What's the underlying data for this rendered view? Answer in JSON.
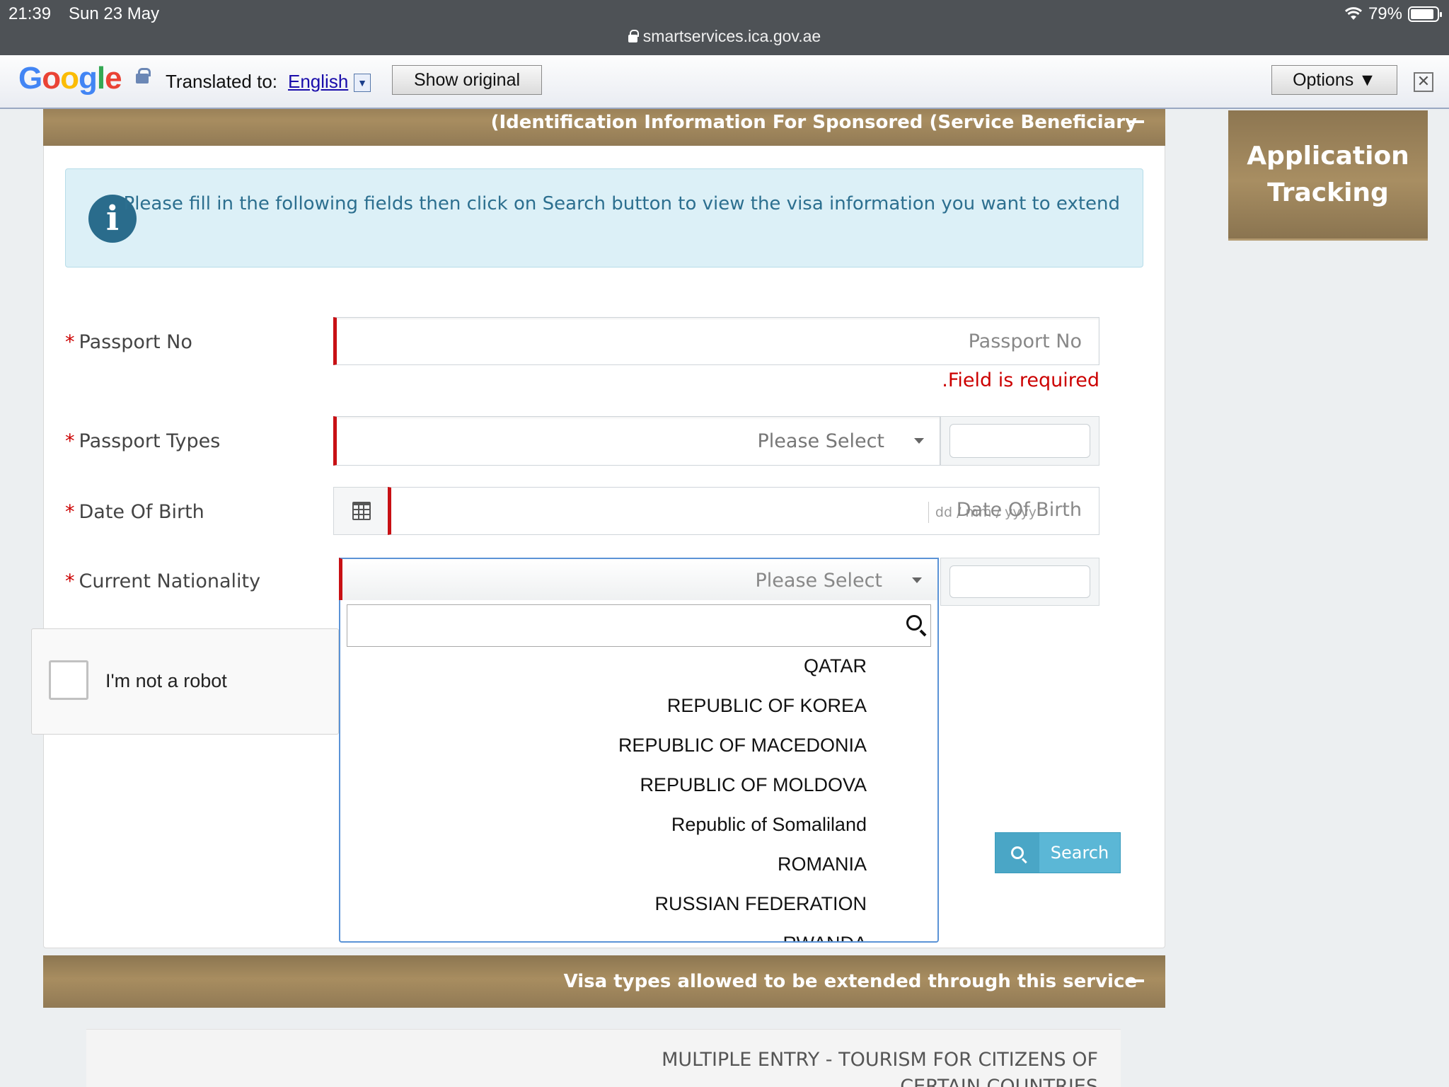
{
  "status_bar": {
    "time": "21:39",
    "date": "Sun 23 May",
    "battery": "79%",
    "url": "smartservices.ica.gov.ae"
  },
  "translate_bar": {
    "logo": "Google",
    "translated_to_label": "Translated to:",
    "language": "English",
    "show_original": "Show original",
    "options": "Options ▼",
    "close": "✕"
  },
  "sections": {
    "identification_header": "(Identification Information For Sponsored (Service Beneficiary",
    "visa_types_header": "Visa types allowed to be extended through this service"
  },
  "info_message": "Please fill in the following fields then click on Search button to view the visa information you want to extend",
  "form": {
    "passport_no": {
      "label": "Passport No",
      "placeholder": "Passport No",
      "error": ".Field is required"
    },
    "passport_types": {
      "label": "Passport Types",
      "selected": "Please Select"
    },
    "date_of_birth": {
      "label": "Date Of Birth",
      "placeholder": "Date Of Birth",
      "format_hint": "dd / mm / yyyy"
    },
    "current_nationality": {
      "label": "Current Nationality",
      "selected": "Please Select",
      "options": [
        "QATAR",
        "REPUBLIC OF KOREA",
        "REPUBLIC OF MACEDONIA",
        "REPUBLIC OF MOLDOVA",
        "Republic of Somaliland",
        "ROMANIA",
        "RUSSIAN FEDERATION",
        "RWANDA"
      ]
    },
    "required_mark": "*"
  },
  "captcha": {
    "label": "I'm not a robot"
  },
  "search_button": "Search",
  "application_tracking": "Application Tracking",
  "visa_types": [
    "MULTIPLE ENTRY - TOURISM FOR CITIZENS OF CERTAIN COUNTRIES"
  ]
}
